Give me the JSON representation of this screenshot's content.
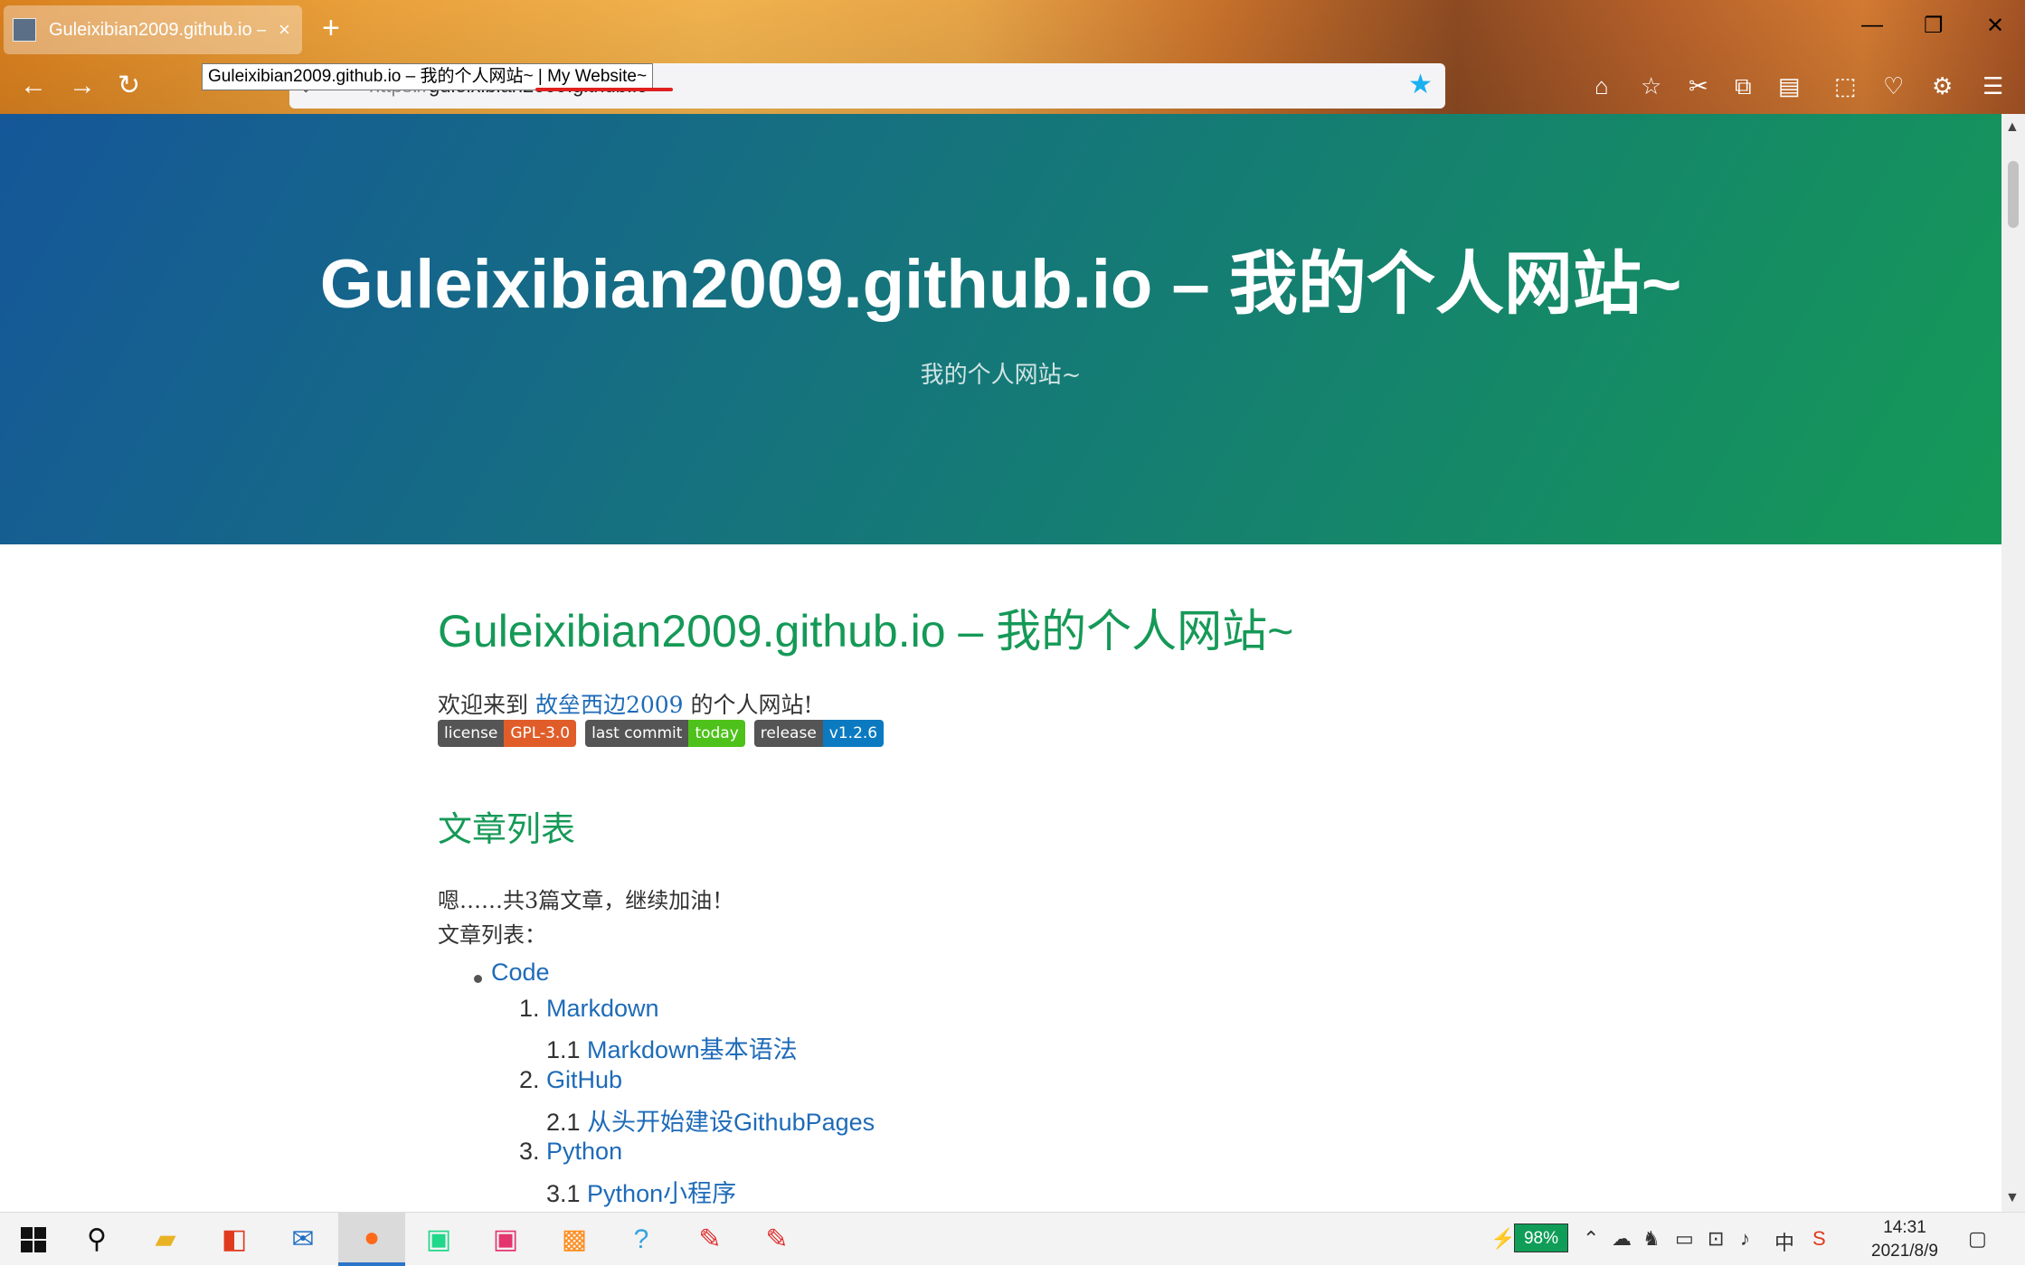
{
  "browser": {
    "tab_title": "Guleixibian2009.github.io –",
    "tab_close": "×",
    "new_tab": "+",
    "url_scheme": "https://",
    "url_host": "guleixibian2009.github.io",
    "tooltip": "Guleixibian2009.github.io – 我的个人网站~ | My Website~",
    "window_controls": {
      "minimize": "—",
      "restore": "❐",
      "close": "✕"
    },
    "nav": {
      "back": "←",
      "forward": "→",
      "reload": "↻"
    },
    "bookmark_star": "★",
    "toolbar_icons": [
      "home-icon",
      "star-outline-icon",
      "scissors-icon",
      "copy-icon",
      "clipboard-icon",
      "extension-icon",
      "pocket-icon",
      "gear-icon",
      "menu-icon"
    ]
  },
  "hero": {
    "title": "Guleixibian2009.github.io – 我的个人网站~",
    "tagline": "我的个人网站~"
  },
  "content": {
    "heading": "Guleixibian2009.github.io – 我的个人网站~",
    "welcome_prefix": "欢迎来到 ",
    "welcome_link": "故垒西边2009",
    "welcome_suffix": " 的个人网站!",
    "badges": [
      {
        "key": "license",
        "value": "GPL-3.0",
        "color": "#e05d2a"
      },
      {
        "key": "last commit",
        "value": "today",
        "color": "#4ec21a"
      },
      {
        "key": "release",
        "value": "v1.2.6",
        "color": "#0c7ac1"
      }
    ],
    "section_title": "文章列表",
    "count_text": "嗯……共3篇文章，继续加油！",
    "list_label": "文章列表：",
    "tree": [
      {
        "num": "",
        "label": "Code"
      },
      {
        "num": "1. ",
        "label": "Markdown"
      },
      {
        "num": "1.1 ",
        "label": "Markdown基本语法"
      },
      {
        "num": "2. ",
        "label": "GitHub"
      },
      {
        "num": "2.1 ",
        "label": "从头开始建设GithubPages"
      },
      {
        "num": "3. ",
        "label": "Python"
      },
      {
        "num": "3.1 ",
        "label": "Python小程序"
      }
    ]
  },
  "taskbar": {
    "battery": "98%",
    "ime": "中",
    "time": "14:31",
    "date": "2021/8/9"
  }
}
